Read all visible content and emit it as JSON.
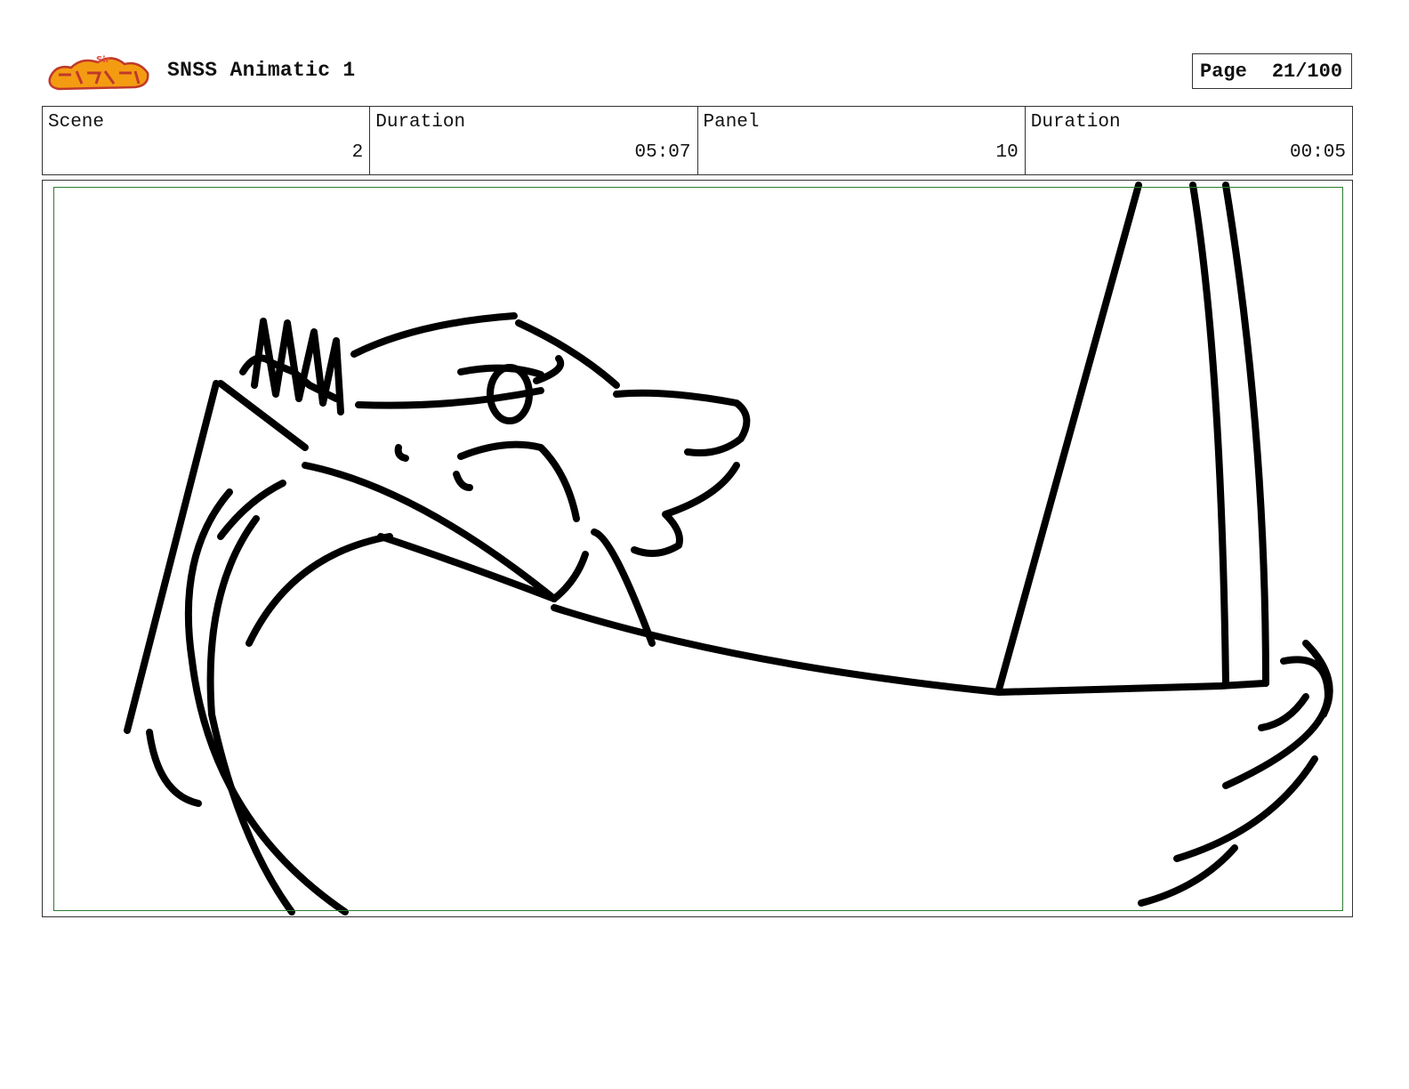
{
  "header": {
    "logo_text": "Sir Snoop-so-Stoop",
    "title": "SNSS Animatic 1",
    "page_label": "Page",
    "page_number": "21/100"
  },
  "info": [
    {
      "label": "Scene",
      "value": "2"
    },
    {
      "label": "Duration",
      "value": "05:07"
    },
    {
      "label": "Panel",
      "value": "10"
    },
    {
      "label": "Duration",
      "value": "00:05"
    }
  ],
  "colors": {
    "safe_area_border": "#2e7d32",
    "logo_fill": "#f39c12",
    "logo_outline": "#c0392b"
  },
  "panel_image": "storyboard-sketch"
}
